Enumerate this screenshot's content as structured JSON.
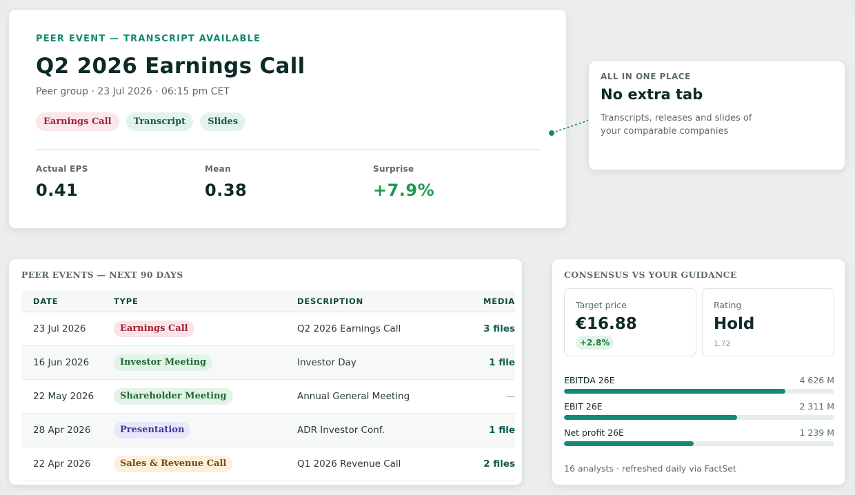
{
  "hero": {
    "kicker": "PEER EVENT — TRANSCRIPT AVAILABLE",
    "title": "Q2 2026 Earnings Call",
    "meta": "Peer group · 23 Jul 2026 · 06:15 pm CET",
    "chips": [
      "Earnings Call",
      "Transcript",
      "Slides"
    ],
    "stats": [
      {
        "label": "Actual EPS",
        "value": "0.41"
      },
      {
        "label": "Mean",
        "value": "0.38"
      },
      {
        "label": "Surprise",
        "value": "+7.9%"
      }
    ]
  },
  "callout": {
    "kicker": "ALL IN ONE PLACE",
    "title": "No extra tab",
    "desc": "Transcripts, releases and slides of your comparable companies"
  },
  "events": {
    "heading": "PEER EVENTS — NEXT 90 DAYS",
    "columns": [
      "DATE",
      "TYPE",
      "DESCRIPTION",
      "MEDIA"
    ],
    "rows": [
      {
        "date": "23 Jul 2026",
        "type": "Earnings Call",
        "desc": "Q2 2026 Earnings Call",
        "media": "3 files"
      },
      {
        "date": "16 Jun 2026",
        "type": "Investor Meeting",
        "desc": "Investor Day",
        "media": "1 file"
      },
      {
        "date": "22 May 2026",
        "type": "Shareholder Meeting",
        "desc": "Annual General Meeting",
        "media": "—"
      },
      {
        "date": "28 Apr 2026",
        "type": "Presentation",
        "desc": "ADR Investor Conf.",
        "media": "1 file"
      },
      {
        "date": "22 Apr 2026",
        "type": "Sales & Revenue Call",
        "desc": "Q1 2026 Revenue Call",
        "media": "2 files"
      }
    ]
  },
  "consensus": {
    "heading": "CONSENSUS VS YOUR GUIDANCE",
    "target": {
      "label": "Target price",
      "value": "€16.88",
      "delta": "+2.8%"
    },
    "rating": {
      "label": "Rating",
      "value": "Hold",
      "sub": "1.72"
    },
    "metrics": [
      {
        "label": "EBITDA 26E",
        "value": "4 626 M",
        "fraction": 0.82
      },
      {
        "label": "EBIT 26E",
        "value": "2 311 M",
        "fraction": 0.64
      },
      {
        "label": "Net profit 26E",
        "value": "1 239 M",
        "fraction": 0.48
      }
    ],
    "footer": "16 analysts · refreshed daily via FactSet"
  },
  "colors": {
    "accent": "#138a70",
    "positive": "#1f9a4c",
    "bar": "#16887a",
    "tag_red": "#9d2438",
    "tag_green": "#1f6a35",
    "tag_purple": "#3b3a9a",
    "tag_amber": "#7b4a0e"
  }
}
